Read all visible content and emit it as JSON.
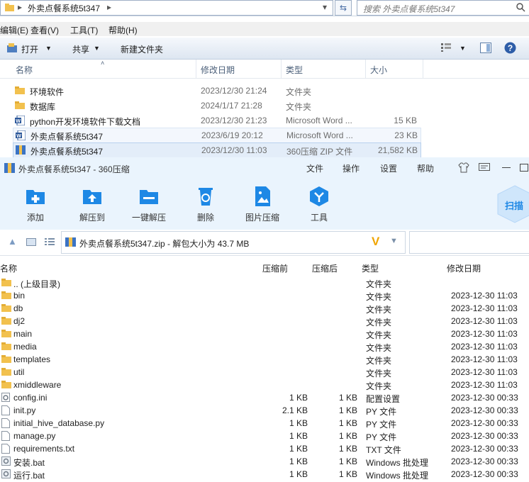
{
  "explorer": {
    "breadcrumb": "外卖点餐系统5t347",
    "search_placeholder": "搜索 外卖点餐系统5t347",
    "menu": [
      "编辑(E)",
      "查看(V)",
      "工具(T)",
      "帮助(H)"
    ],
    "toolbar": {
      "open": "打开",
      "share": "共享",
      "new_folder": "新建文件夹"
    },
    "columns": [
      "名称",
      "修改日期",
      "类型",
      "大小"
    ],
    "files": [
      {
        "name": "环境软件",
        "date": "2023/12/30 21:24",
        "type": "文件夹",
        "size": "",
        "icon": "folder-icon"
      },
      {
        "name": "数据库",
        "date": "2024/1/17 21:28",
        "type": "文件夹",
        "size": "",
        "icon": "folder-icon"
      },
      {
        "name": "python开发环境软件下载文档",
        "date": "2023/12/30 21:23",
        "type": "Microsoft Word ...",
        "size": "15 KB",
        "icon": "word-icon"
      },
      {
        "name": "外卖点餐系统5t347",
        "date": "2023/6/19 20:12",
        "type": "Microsoft Word ...",
        "size": "23 KB",
        "icon": "word-icon"
      },
      {
        "name": "外卖点餐系统5t347",
        "date": "2023/12/30 11:03",
        "type": "360压缩 ZIP 文件",
        "size": "21,582 KB",
        "icon": "zip-icon"
      }
    ]
  },
  "zip": {
    "title": "外卖点餐系统5t347 - 360压缩",
    "menu": [
      "文件",
      "操作",
      "设置",
      "帮助"
    ],
    "tools": [
      "添加",
      "解压到",
      "一键解压",
      "删除",
      "图片压缩",
      "工具"
    ],
    "scan_label": "扫描",
    "path": "外卖点餐系统5t347.zip - 解包大小为 43.7 MB",
    "columns": [
      "名称",
      "压缩前",
      "压缩后",
      "类型",
      "修改日期"
    ],
    "rows": [
      {
        "name": ".. (上级目录)",
        "before": "",
        "after": "",
        "type": "文件夹",
        "date": "",
        "icon": "folder-icon"
      },
      {
        "name": "bin",
        "before": "",
        "after": "",
        "type": "文件夹",
        "date": "2023-12-30 11:03",
        "icon": "folder-icon"
      },
      {
        "name": "db",
        "before": "",
        "after": "",
        "type": "文件夹",
        "date": "2023-12-30 11:03",
        "icon": "folder-icon"
      },
      {
        "name": "dj2",
        "before": "",
        "after": "",
        "type": "文件夹",
        "date": "2023-12-30 11:03",
        "icon": "folder-icon"
      },
      {
        "name": "main",
        "before": "",
        "after": "",
        "type": "文件夹",
        "date": "2023-12-30 11:03",
        "icon": "folder-icon"
      },
      {
        "name": "media",
        "before": "",
        "after": "",
        "type": "文件夹",
        "date": "2023-12-30 11:03",
        "icon": "folder-icon"
      },
      {
        "name": "templates",
        "before": "",
        "after": "",
        "type": "文件夹",
        "date": "2023-12-30 11:03",
        "icon": "folder-icon"
      },
      {
        "name": "util",
        "before": "",
        "after": "",
        "type": "文件夹",
        "date": "2023-12-30 11:03",
        "icon": "folder-icon"
      },
      {
        "name": "xmiddleware",
        "before": "",
        "after": "",
        "type": "文件夹",
        "date": "2023-12-30 11:03",
        "icon": "folder-icon"
      },
      {
        "name": "config.ini",
        "before": "1 KB",
        "after": "1 KB",
        "type": "配置设置",
        "date": "2023-12-30 00:33",
        "icon": "config-icon"
      },
      {
        "name": "init.py",
        "before": "2.1 KB",
        "after": "1 KB",
        "type": "PY 文件",
        "date": "2023-12-30 00:33",
        "icon": "file-icon"
      },
      {
        "name": "initial_hive_database.py",
        "before": "1 KB",
        "after": "1 KB",
        "type": "PY 文件",
        "date": "2023-12-30 00:33",
        "icon": "file-icon"
      },
      {
        "name": "manage.py",
        "before": "1 KB",
        "after": "1 KB",
        "type": "PY 文件",
        "date": "2023-12-30 00:33",
        "icon": "file-icon"
      },
      {
        "name": "requirements.txt",
        "before": "1 KB",
        "after": "1 KB",
        "type": "TXT 文件",
        "date": "2023-12-30 00:33",
        "icon": "file-icon"
      },
      {
        "name": "安装.bat",
        "before": "1 KB",
        "after": "1 KB",
        "type": "Windows 批处理",
        "date": "2023-12-30 00:33",
        "icon": "bat-icon"
      },
      {
        "name": "运行.bat",
        "before": "1 KB",
        "after": "1 KB",
        "type": "Windows 批处理",
        "date": "2023-12-30 00:33",
        "icon": "bat-icon"
      }
    ]
  }
}
